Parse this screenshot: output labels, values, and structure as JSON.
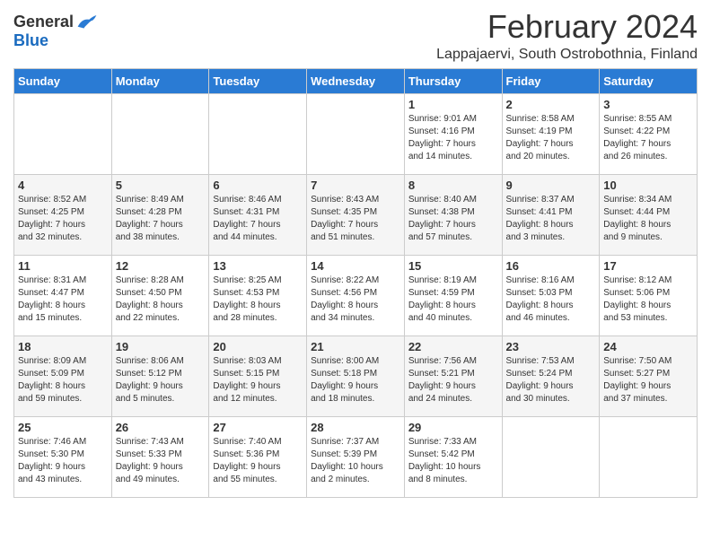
{
  "logo": {
    "general": "General",
    "blue": "Blue"
  },
  "title": "February 2024",
  "location": "Lappajaervi, South Ostrobothnia, Finland",
  "days_header": [
    "Sunday",
    "Monday",
    "Tuesday",
    "Wednesday",
    "Thursday",
    "Friday",
    "Saturday"
  ],
  "weeks": [
    [
      {
        "day": "",
        "info": ""
      },
      {
        "day": "",
        "info": ""
      },
      {
        "day": "",
        "info": ""
      },
      {
        "day": "",
        "info": ""
      },
      {
        "day": "1",
        "info": "Sunrise: 9:01 AM\nSunset: 4:16 PM\nDaylight: 7 hours\nand 14 minutes."
      },
      {
        "day": "2",
        "info": "Sunrise: 8:58 AM\nSunset: 4:19 PM\nDaylight: 7 hours\nand 20 minutes."
      },
      {
        "day": "3",
        "info": "Sunrise: 8:55 AM\nSunset: 4:22 PM\nDaylight: 7 hours\nand 26 minutes."
      }
    ],
    [
      {
        "day": "4",
        "info": "Sunrise: 8:52 AM\nSunset: 4:25 PM\nDaylight: 7 hours\nand 32 minutes."
      },
      {
        "day": "5",
        "info": "Sunrise: 8:49 AM\nSunset: 4:28 PM\nDaylight: 7 hours\nand 38 minutes."
      },
      {
        "day": "6",
        "info": "Sunrise: 8:46 AM\nSunset: 4:31 PM\nDaylight: 7 hours\nand 44 minutes."
      },
      {
        "day": "7",
        "info": "Sunrise: 8:43 AM\nSunset: 4:35 PM\nDaylight: 7 hours\nand 51 minutes."
      },
      {
        "day": "8",
        "info": "Sunrise: 8:40 AM\nSunset: 4:38 PM\nDaylight: 7 hours\nand 57 minutes."
      },
      {
        "day": "9",
        "info": "Sunrise: 8:37 AM\nSunset: 4:41 PM\nDaylight: 8 hours\nand 3 minutes."
      },
      {
        "day": "10",
        "info": "Sunrise: 8:34 AM\nSunset: 4:44 PM\nDaylight: 8 hours\nand 9 minutes."
      }
    ],
    [
      {
        "day": "11",
        "info": "Sunrise: 8:31 AM\nSunset: 4:47 PM\nDaylight: 8 hours\nand 15 minutes."
      },
      {
        "day": "12",
        "info": "Sunrise: 8:28 AM\nSunset: 4:50 PM\nDaylight: 8 hours\nand 22 minutes."
      },
      {
        "day": "13",
        "info": "Sunrise: 8:25 AM\nSunset: 4:53 PM\nDaylight: 8 hours\nand 28 minutes."
      },
      {
        "day": "14",
        "info": "Sunrise: 8:22 AM\nSunset: 4:56 PM\nDaylight: 8 hours\nand 34 minutes."
      },
      {
        "day": "15",
        "info": "Sunrise: 8:19 AM\nSunset: 4:59 PM\nDaylight: 8 hours\nand 40 minutes."
      },
      {
        "day": "16",
        "info": "Sunrise: 8:16 AM\nSunset: 5:03 PM\nDaylight: 8 hours\nand 46 minutes."
      },
      {
        "day": "17",
        "info": "Sunrise: 8:12 AM\nSunset: 5:06 PM\nDaylight: 8 hours\nand 53 minutes."
      }
    ],
    [
      {
        "day": "18",
        "info": "Sunrise: 8:09 AM\nSunset: 5:09 PM\nDaylight: 8 hours\nand 59 minutes."
      },
      {
        "day": "19",
        "info": "Sunrise: 8:06 AM\nSunset: 5:12 PM\nDaylight: 9 hours\nand 5 minutes."
      },
      {
        "day": "20",
        "info": "Sunrise: 8:03 AM\nSunset: 5:15 PM\nDaylight: 9 hours\nand 12 minutes."
      },
      {
        "day": "21",
        "info": "Sunrise: 8:00 AM\nSunset: 5:18 PM\nDaylight: 9 hours\nand 18 minutes."
      },
      {
        "day": "22",
        "info": "Sunrise: 7:56 AM\nSunset: 5:21 PM\nDaylight: 9 hours\nand 24 minutes."
      },
      {
        "day": "23",
        "info": "Sunrise: 7:53 AM\nSunset: 5:24 PM\nDaylight: 9 hours\nand 30 minutes."
      },
      {
        "day": "24",
        "info": "Sunrise: 7:50 AM\nSunset: 5:27 PM\nDaylight: 9 hours\nand 37 minutes."
      }
    ],
    [
      {
        "day": "25",
        "info": "Sunrise: 7:46 AM\nSunset: 5:30 PM\nDaylight: 9 hours\nand 43 minutes."
      },
      {
        "day": "26",
        "info": "Sunrise: 7:43 AM\nSunset: 5:33 PM\nDaylight: 9 hours\nand 49 minutes."
      },
      {
        "day": "27",
        "info": "Sunrise: 7:40 AM\nSunset: 5:36 PM\nDaylight: 9 hours\nand 55 minutes."
      },
      {
        "day": "28",
        "info": "Sunrise: 7:37 AM\nSunset: 5:39 PM\nDaylight: 10 hours\nand 2 minutes."
      },
      {
        "day": "29",
        "info": "Sunrise: 7:33 AM\nSunset: 5:42 PM\nDaylight: 10 hours\nand 8 minutes."
      },
      {
        "day": "",
        "info": ""
      },
      {
        "day": "",
        "info": ""
      }
    ]
  ]
}
